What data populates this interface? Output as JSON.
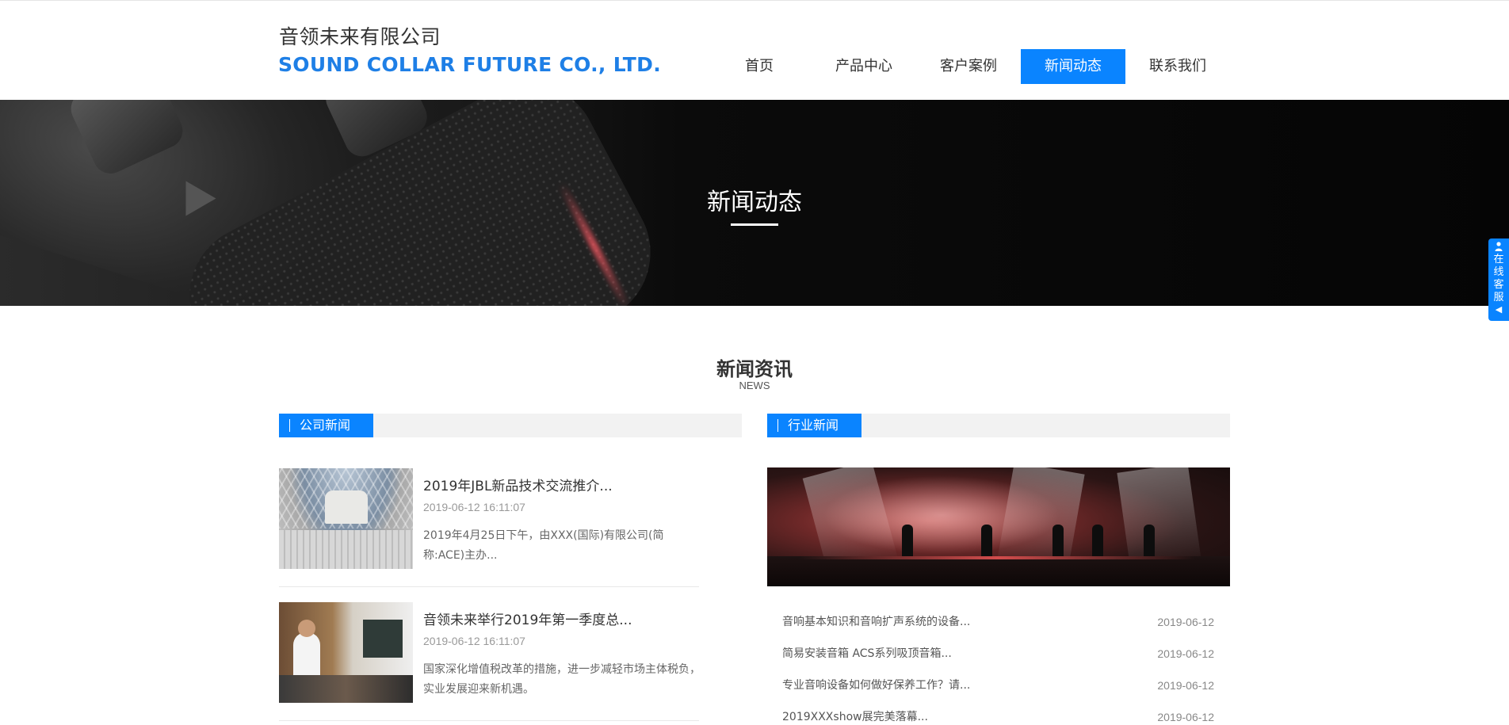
{
  "header": {
    "logo_cn": "音领未来有限公司",
    "logo_en": "SOUND COLLAR FUTURE CO., LTD.",
    "nav": [
      {
        "label": "首页",
        "active": false
      },
      {
        "label": "产品中心",
        "active": false
      },
      {
        "label": "客户案例",
        "active": false
      },
      {
        "label": "新闻动态",
        "active": true
      },
      {
        "label": "联系我们",
        "active": false
      }
    ]
  },
  "banner": {
    "title": "新闻动态"
  },
  "side_tab": {
    "label": "在线客服",
    "icon": "person-icon",
    "arrow": "◀"
  },
  "section": {
    "title": "新闻资讯",
    "subtitle": "NEWS"
  },
  "company_news": {
    "tab_label": "公司新闻",
    "items": [
      {
        "title": "2019年JBL新品技术交流推介...",
        "date": "2019-06-12 16:11:07",
        "desc": "2019年4月25日下午，由XXX(国际)有限公司(简称:ACE)主办..."
      },
      {
        "title": "音领未来举行2019年第一季度总...",
        "date": "2019-06-12 16:11:07",
        "desc": "国家深化增值税改革的措施，进一步减轻市场主体税负，实业发展迎来新机遇。"
      }
    ]
  },
  "industry_news": {
    "tab_label": "行业新闻",
    "items": [
      {
        "title": "音响基本知识和音响扩声系统的设备...",
        "date": "2019-06-12"
      },
      {
        "title": "简易安装音箱 ACS系列吸顶音箱...",
        "date": "2019-06-12"
      },
      {
        "title": "专业音响设备如何做好保养工作？请...",
        "date": "2019-06-12"
      },
      {
        "title": "2019XXXshow展完美落幕...",
        "date": "2019-06-12"
      }
    ]
  },
  "colors": {
    "accent": "#0a84ff",
    "logo_en": "#1e7fe6"
  }
}
